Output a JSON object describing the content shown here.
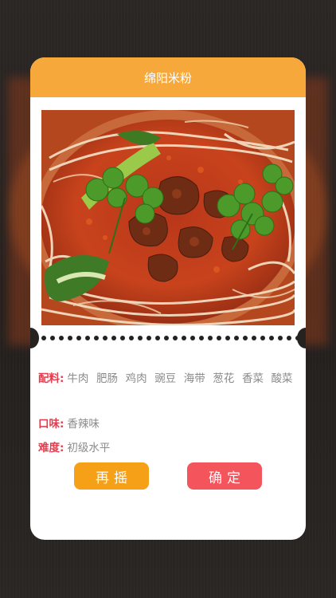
{
  "card": {
    "title": "绵阳米粉"
  },
  "details": {
    "ingredients_label": "配料:",
    "ingredients": [
      "牛肉",
      "肥肠",
      "鸡肉",
      "豌豆",
      "海带",
      "葱花",
      "香菜",
      "酸菜"
    ],
    "taste_label": "口味:",
    "taste_value": "香辣味",
    "difficulty_label": "难度:",
    "difficulty_value": "初级水平"
  },
  "buttons": {
    "shake_again": "再摇",
    "confirm": "确定"
  },
  "colors": {
    "header": "#f7a83a",
    "shake_button": "#f5a017",
    "confirm_button": "#f4545c",
    "label_red": "#e23d4e"
  }
}
